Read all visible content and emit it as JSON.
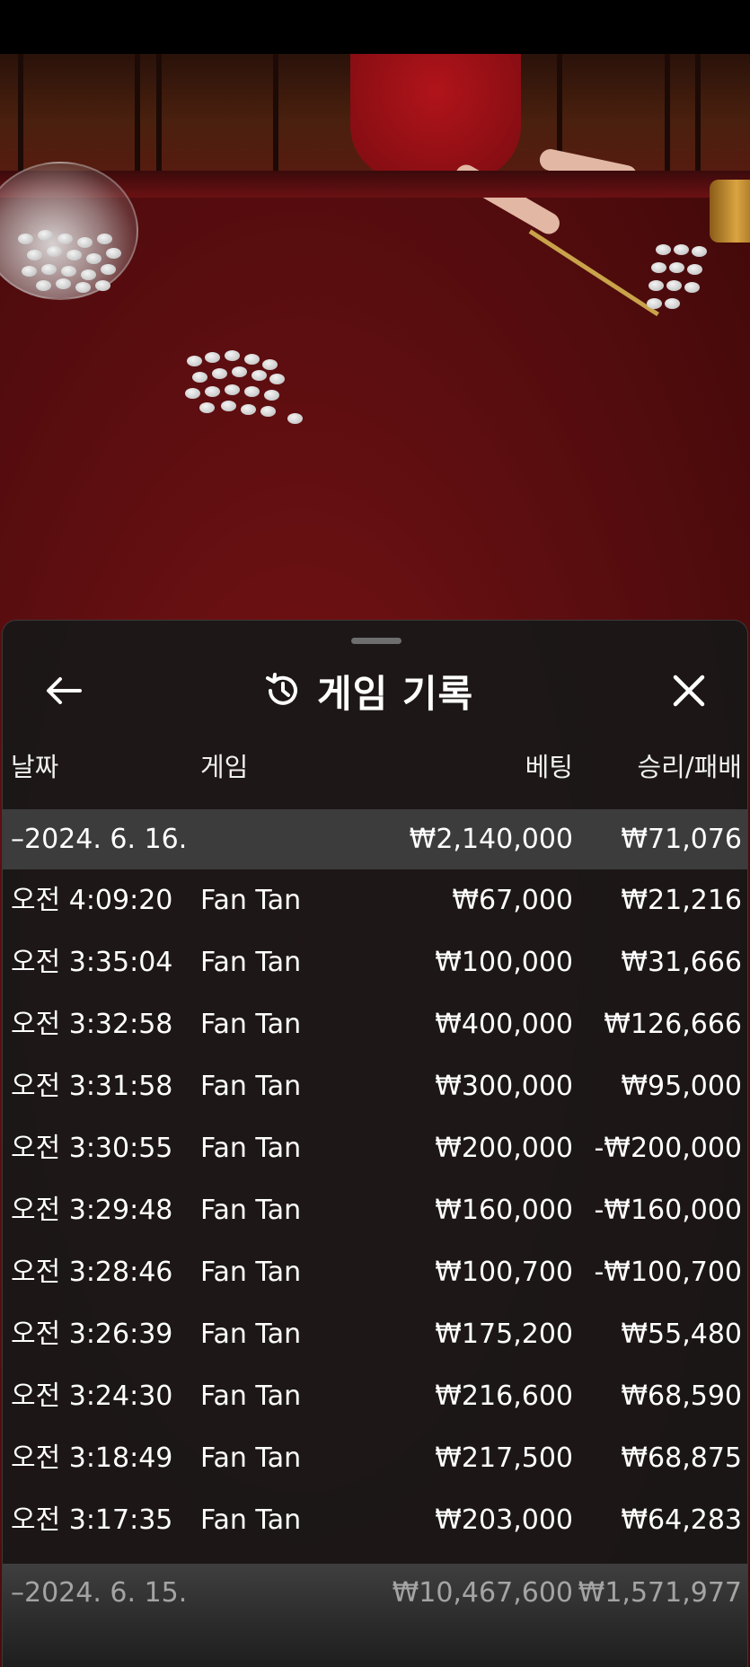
{
  "sheet": {
    "title": "게임 기록",
    "back_icon": "arrow-left-icon",
    "history_icon": "history-clock-icon",
    "close_icon": "close-icon"
  },
  "columns": {
    "date": "날짜",
    "game": "게임",
    "bet": "베팅",
    "win_loss": "승리/패배"
  },
  "groups": [
    {
      "date": "–2024. 6. 16.",
      "bet_total": "₩2,140,000",
      "win_total": "₩71,076",
      "rows": [
        {
          "time": "오전 4:09:20",
          "game": "Fan Tan",
          "bet": "₩67,000",
          "win": "₩21,216"
        },
        {
          "time": "오전 3:35:04",
          "game": "Fan Tan",
          "bet": "₩100,000",
          "win": "₩31,666"
        },
        {
          "time": "오전 3:32:58",
          "game": "Fan Tan",
          "bet": "₩400,000",
          "win": "₩126,666"
        },
        {
          "time": "오전 3:31:58",
          "game": "Fan Tan",
          "bet": "₩300,000",
          "win": "₩95,000"
        },
        {
          "time": "오전 3:30:55",
          "game": "Fan Tan",
          "bet": "₩200,000",
          "win": "-₩200,000"
        },
        {
          "time": "오전 3:29:48",
          "game": "Fan Tan",
          "bet": "₩160,000",
          "win": "-₩160,000"
        },
        {
          "time": "오전 3:28:46",
          "game": "Fan Tan",
          "bet": "₩100,700",
          "win": "-₩100,700"
        },
        {
          "time": "오전 3:26:39",
          "game": "Fan Tan",
          "bet": "₩175,200",
          "win": "₩55,480"
        },
        {
          "time": "오전 3:24:30",
          "game": "Fan Tan",
          "bet": "₩216,600",
          "win": "₩68,590"
        },
        {
          "time": "오전 3:18:49",
          "game": "Fan Tan",
          "bet": "₩217,500",
          "win": "₩68,875"
        },
        {
          "time": "오전 3:17:35",
          "game": "Fan Tan",
          "bet": "₩203,000",
          "win": "₩64,283"
        }
      ]
    },
    {
      "date": "–2024. 6. 15.",
      "bet_total": "₩10,467,600",
      "win_total": "₩1,571,977"
    }
  ]
}
